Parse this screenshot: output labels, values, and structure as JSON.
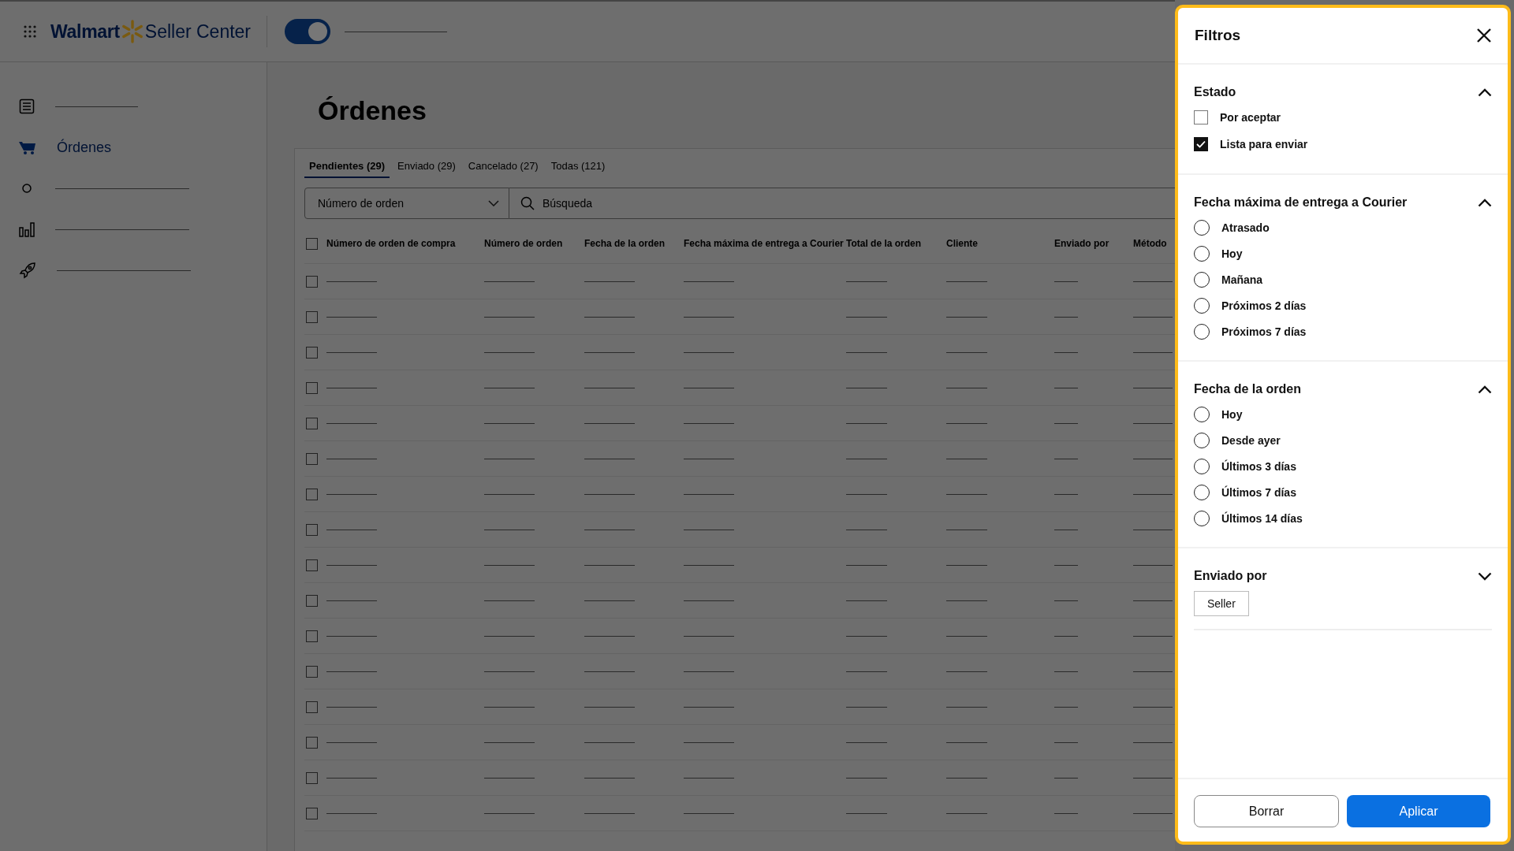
{
  "header": {
    "brand": "Walmart",
    "product": "Seller Center",
    "toggle": {
      "on": true
    }
  },
  "sidebar": {
    "items": [
      {
        "selected": false
      },
      {
        "label": "Órdenes",
        "selected": true
      },
      {
        "selected": false
      },
      {
        "selected": false
      },
      {
        "selected": false
      }
    ]
  },
  "page": {
    "title": "Órdenes",
    "tabs": [
      {
        "label": "Pendientes (29)",
        "selected": true
      },
      {
        "label": "Enviado (29)",
        "selected": false
      },
      {
        "label": "Cancelado (27)",
        "selected": false
      },
      {
        "label": "Todas (121)",
        "selected": false
      }
    ],
    "filter_select": {
      "placeholder": "Número de orden"
    },
    "search": {
      "placeholder": "Búsqueda"
    },
    "table": {
      "columns": [
        "Número de orden de compra",
        "Número de orden",
        "Fecha de la orden",
        "Fecha máxima de entrega a Courier",
        "Total de la orden",
        "Cliente",
        "Enviado por",
        "Método"
      ],
      "select_all": {
        "checked": false
      },
      "rows": [
        {
          "checked": false
        },
        {
          "checked": false
        },
        {
          "checked": false
        },
        {
          "checked": false
        },
        {
          "checked": false
        },
        {
          "checked": false
        },
        {
          "checked": false
        },
        {
          "checked": false
        },
        {
          "checked": false
        },
        {
          "checked": false
        },
        {
          "checked": false
        },
        {
          "checked": false
        },
        {
          "checked": false
        },
        {
          "checked": false
        },
        {
          "checked": false
        },
        {
          "checked": false
        }
      ]
    }
  },
  "drawer": {
    "title": "Filtros",
    "sections": [
      {
        "title": "Estado",
        "expanded": true,
        "kind": "checkbox",
        "options": [
          {
            "label": "Por aceptar",
            "checked": false
          },
          {
            "label": "Lista para enviar",
            "checked": true
          }
        ]
      },
      {
        "title": "Fecha máxima de entrega a Courier",
        "expanded": true,
        "kind": "radio",
        "options": [
          {
            "label": "Atrasado",
            "selected": false
          },
          {
            "label": "Hoy",
            "selected": false
          },
          {
            "label": "Mañana",
            "selected": false
          },
          {
            "label": "Próximos 2 días",
            "selected": false
          },
          {
            "label": "Próximos 7 días",
            "selected": false
          }
        ]
      },
      {
        "title": "Fecha de la orden",
        "expanded": true,
        "kind": "radio",
        "options": [
          {
            "label": "Hoy",
            "selected": false
          },
          {
            "label": "Desde ayer",
            "selected": false
          },
          {
            "label": "Últimos 3 días",
            "selected": false
          },
          {
            "label": "Últimos 7 días",
            "selected": false
          },
          {
            "label": "Últimos 14 días",
            "selected": false
          }
        ]
      },
      {
        "title": "Enviado por",
        "expanded": false,
        "kind": "chips",
        "options": [
          {
            "label": "Seller",
            "selected": false
          }
        ]
      }
    ],
    "buttons": [
      {
        "label": "Borrar",
        "kind": "secondary"
      },
      {
        "label": "Aplicar",
        "kind": "primary"
      }
    ]
  }
}
